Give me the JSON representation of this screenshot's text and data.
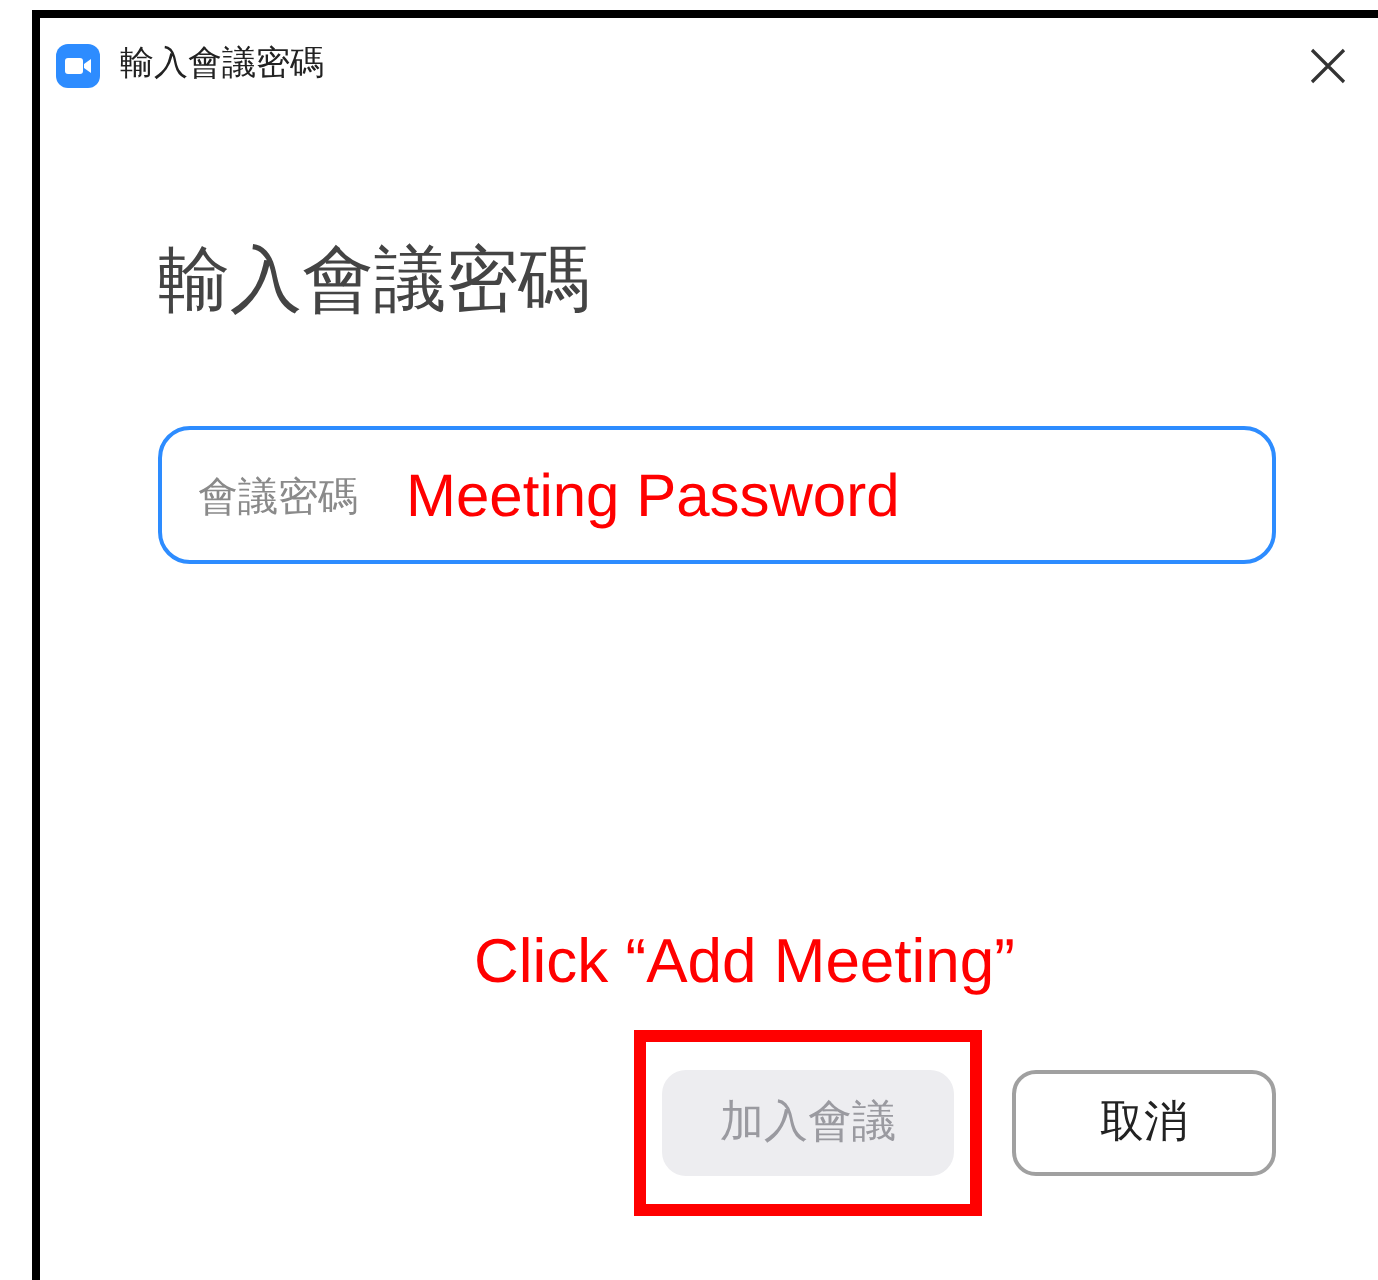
{
  "window": {
    "title": "輸入會議密碼"
  },
  "heading": "輸入會議密碼",
  "password_field": {
    "placeholder": "會議密碼",
    "annotation": "Meeting Password"
  },
  "instruction": "Click “Add Meeting”",
  "buttons": [
    {
      "label": "加入會議",
      "kind": "primary",
      "disabled": true,
      "highlighted": true
    },
    {
      "label": "取消",
      "kind": "secondary",
      "disabled": false,
      "highlighted": false
    }
  ]
}
